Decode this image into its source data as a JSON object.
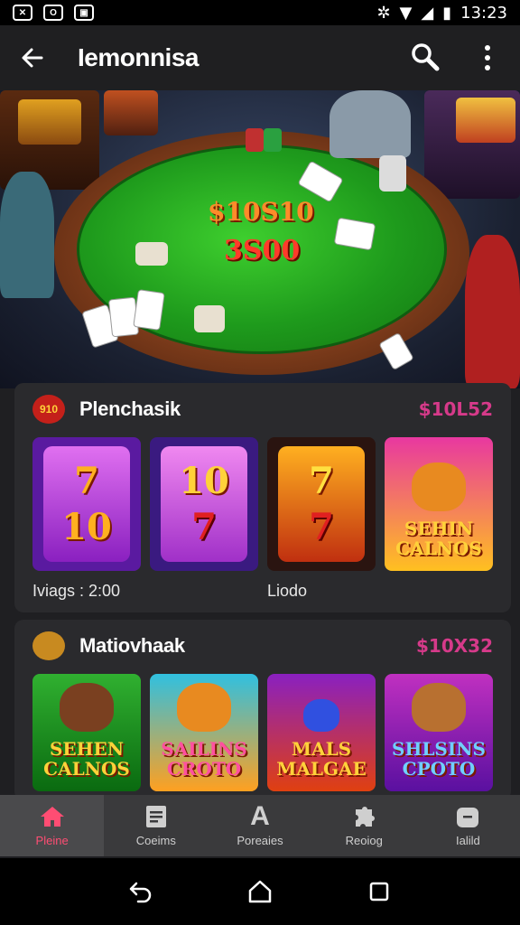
{
  "status_bar": {
    "time": "13:23",
    "left_icons": [
      "photo-icon",
      "notification-icon",
      "media-icon"
    ],
    "right_icons": [
      "bluetooth-icon",
      "wifi-icon",
      "signal-icon",
      "battery-icon"
    ]
  },
  "app_bar": {
    "title": "Iemonnisa",
    "back_icon": "back-arrow-icon",
    "search_icon": "search-icon",
    "menu_icon": "more-vertical-icon"
  },
  "hero": {
    "pot_line1": "$10S10",
    "pot_line2": "3S00"
  },
  "section1": {
    "badge": "910",
    "title": "Plenchasik",
    "amount": "$10L52",
    "caption_left": "Iviags : 2:00",
    "caption_mid": "Liodo",
    "tiles": [
      {
        "top": "7",
        "bottom": "10"
      },
      {
        "top": "10",
        "bottom": "7"
      },
      {
        "top": "7",
        "bottom": "7"
      },
      {
        "label_line1": "SEHIN",
        "label_line2": "CALNOS"
      }
    ]
  },
  "section2": {
    "title": "Matiovhaak",
    "amount": "$10X32",
    "tiles": [
      {
        "label_line1": "SEHEN",
        "label_line2": "CALNOS"
      },
      {
        "label_line1": "SAILINS",
        "label_line2": "CROTO"
      },
      {
        "label_line1": "MALS",
        "label_line2": "MALGAE"
      },
      {
        "label_line1": "SHLSINS",
        "label_line2": "CPOTO"
      }
    ]
  },
  "bottom_nav": [
    {
      "label": "Pleine",
      "icon": "home-icon",
      "active": true
    },
    {
      "label": "Coeims",
      "icon": "document-icon",
      "active": false
    },
    {
      "label": "Poreaies",
      "icon": "letter-a-icon",
      "active": false
    },
    {
      "label": "Reoiog",
      "icon": "puzzle-icon",
      "active": false
    },
    {
      "label": "Ialild",
      "icon": "tag-icon",
      "active": false
    }
  ],
  "colors": {
    "accent": "#ff4d73",
    "amount": "#d63a8a",
    "felt": "#2fb82a"
  }
}
